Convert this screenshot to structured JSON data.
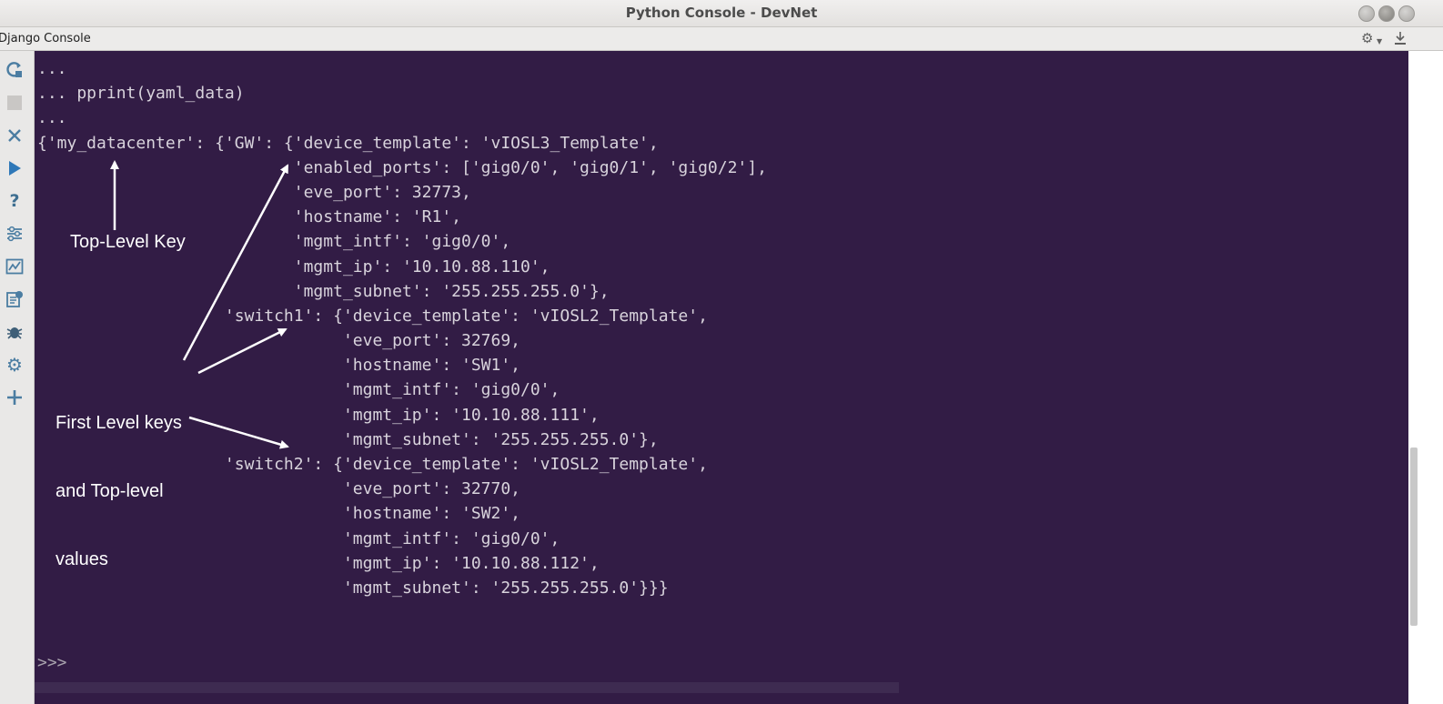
{
  "window": {
    "title": "Python Console - DevNet"
  },
  "tool_window": {
    "title": "Django Console",
    "icons": [
      "gear-icon",
      "chevron-down-icon",
      "hide-icon"
    ]
  },
  "toolbar": {
    "buttons": [
      "rerun-icon",
      "stop-icon",
      "close-icon",
      "execute-icon",
      "help-icon",
      "settings-toggle-icon",
      "variables-icon",
      "history-icon",
      "debug-icon",
      "gear-icon",
      "add-icon"
    ]
  },
  "console": {
    "lines": [
      "...",
      "... pprint(yaml_data)",
      "...",
      "{'my_datacenter': {'GW': {'device_template': 'vIOSL3_Template',",
      "                          'enabled_ports': ['gig0/0', 'gig0/1', 'gig0/2'],",
      "                          'eve_port': 32773,",
      "                          'hostname': 'R1',",
      "                          'mgmt_intf': 'gig0/0',",
      "                          'mgmt_ip': '10.10.88.110',",
      "                          'mgmt_subnet': '255.255.255.0'},",
      "                   'switch1': {'device_template': 'vIOSL2_Template',",
      "                               'eve_port': 32769,",
      "                               'hostname': 'SW1',",
      "                               'mgmt_intf': 'gig0/0',",
      "                               'mgmt_ip': '10.10.88.111',",
      "                               'mgmt_subnet': '255.255.255.0'},",
      "                   'switch2': {'device_template': 'vIOSL2_Template',",
      "                               'eve_port': 32770,",
      "                               'hostname': 'SW2',",
      "                               'mgmt_intf': 'gig0/0',",
      "                               'mgmt_ip': '10.10.88.112',",
      "                               'mgmt_subnet': '255.255.255.0'}}}",
      "",
      "",
      ">>>"
    ],
    "background": "#321c45",
    "text_color": "#d8d3dc"
  },
  "annotations": {
    "top_level": "Top-Level Key",
    "first_level": [
      "First Level keys",
      "and Top-level",
      "values"
    ],
    "color": "#ffffff"
  }
}
